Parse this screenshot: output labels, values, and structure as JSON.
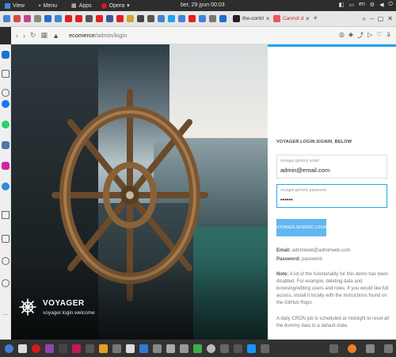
{
  "os_bar": {
    "view": "View",
    "menu": "Menu",
    "apps": "Apps",
    "opera": "Opera",
    "clock": "ber, 29 jyun 00:03",
    "lang": "en"
  },
  "tabs": [
    {
      "label": "the-contri"
    },
    {
      "label": "Cannot d"
    }
  ],
  "address": {
    "host": "ecomerce",
    "path": "/admin/login"
  },
  "hero": {
    "title": "VOYAGER",
    "subtitle": "voyager.login.welcome"
  },
  "login": {
    "heading": "VOYAGER.LOGIN.SIGNIN_BELOW",
    "email_label": "voyager.generic.email",
    "email_value": "admin@email.com",
    "password_label": "voyager.generic.password",
    "password_value": "••••••",
    "button": "VOYAGER.GENERIC.LOGIN",
    "email_line_label": "Email:",
    "email_line_value": "adminweb@adminweb.com",
    "password_line_label": "Password:",
    "password_line_value": "password",
    "note_label": "Note:",
    "note_text": "A lot of the functionality for this demo has been disabled. For example, deleting data and browsing/editing users and roles. If you would like full access, install it locally with the instructions found on the GitHub Repo",
    "cron_text": "A daily CRON job is scheduled at midnight to reset all the dummy data to a default state."
  },
  "colors": {
    "accent": "#22a7f0",
    "button": "#62b7f0"
  }
}
